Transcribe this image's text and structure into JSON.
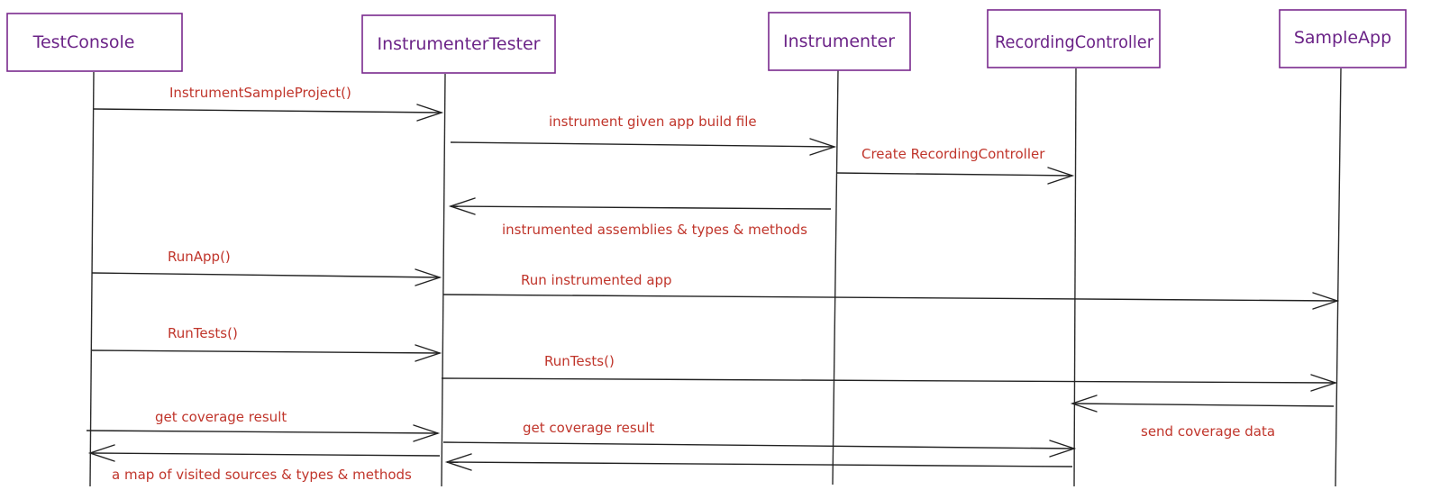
{
  "colors": {
    "actor_border": "#7a2a8e",
    "actor_text": "#6b2387",
    "message_text": "#c0352b",
    "line": "#222222"
  },
  "actors": [
    {
      "id": "testconsole",
      "label": "TestConsole"
    },
    {
      "id": "instrumentertester",
      "label": "InstrumenterTester"
    },
    {
      "id": "instrumenter",
      "label": "Instrumenter"
    },
    {
      "id": "recordingcontroller",
      "label": "RecordingController"
    },
    {
      "id": "sampleapp",
      "label": "SampleApp"
    }
  ],
  "messages": [
    {
      "id": "instrument-sample-project",
      "label": "InstrumentSampleProject()",
      "from": "TestConsole",
      "to": "InstrumenterTester"
    },
    {
      "id": "instrument-given-app-build-file",
      "label": "instrument given app build file",
      "from": "InstrumenterTester",
      "to": "Instrumenter"
    },
    {
      "id": "create-recording-controller",
      "label": "Create RecordingController",
      "from": "Instrumenter",
      "to": "RecordingController"
    },
    {
      "id": "instrumented-assemblies",
      "label": "instrumented assemblies & types & methods",
      "from": "Instrumenter",
      "to": "InstrumenterTester"
    },
    {
      "id": "run-app",
      "label": "RunApp()",
      "from": "TestConsole",
      "to": "InstrumenterTester"
    },
    {
      "id": "run-instrumented-app",
      "label": "Run instrumented app",
      "from": "InstrumenterTester",
      "to": "SampleApp"
    },
    {
      "id": "run-tests-console",
      "label": "RunTests()",
      "from": "TestConsole",
      "to": "InstrumenterTester"
    },
    {
      "id": "run-tests-tester",
      "label": "RunTests()",
      "from": "InstrumenterTester",
      "to": "SampleApp"
    },
    {
      "id": "send-coverage-data",
      "label": "send coverage data",
      "from": "SampleApp",
      "to": "RecordingController"
    },
    {
      "id": "get-coverage-result-console",
      "label": "get coverage result",
      "from": "TestConsole",
      "to": "InstrumenterTester"
    },
    {
      "id": "get-coverage-result-tester",
      "label": "get coverage result",
      "from": "InstrumenterTester",
      "to": "RecordingController"
    },
    {
      "id": "coverage-return",
      "label": "",
      "from": "RecordingController",
      "to": "InstrumenterTester"
    },
    {
      "id": "map-of-visited-sources",
      "label": "a map of visited sources & types & methods",
      "from": "InstrumenterTester",
      "to": "TestConsole"
    }
  ]
}
